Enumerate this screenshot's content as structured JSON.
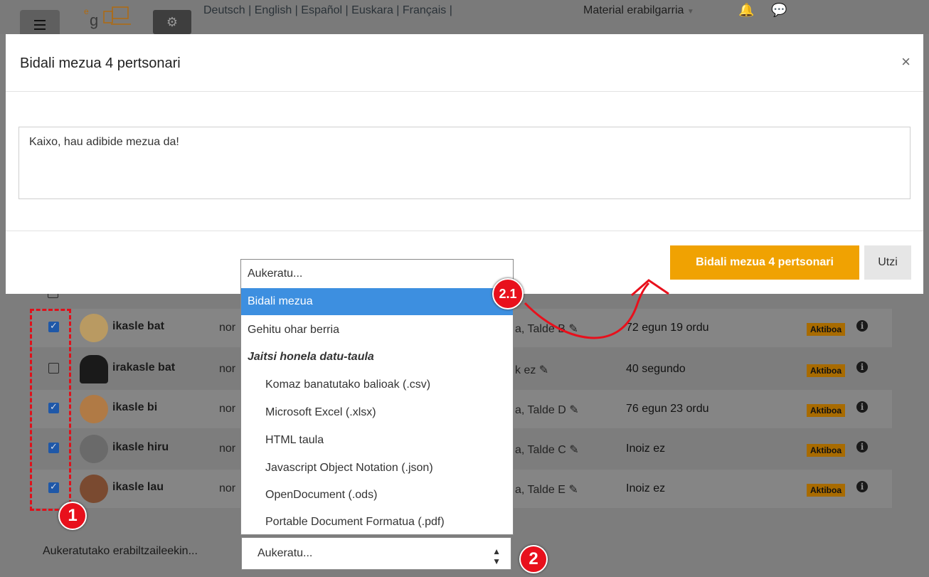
{
  "topbar": {
    "languages": [
      "Deutsch",
      "English",
      "Español",
      "Euskara",
      "Français"
    ],
    "material": "Material erabilgarria"
  },
  "modal": {
    "title": "Bidali mezua 4 pertsonari",
    "close_label": "×",
    "message": "Kaixo, hau adibide mezua da!",
    "send_label": "Bidali mezua 4 pertsonari",
    "cancel_label": "Utzi"
  },
  "dropdown": {
    "options": [
      "Aukeratu...",
      "Bidali mezua",
      "Gehitu ohar berria",
      "Jaitsi honela datu-taula",
      "Komaz banatutako balioak (.csv)",
      "Microsoft Excel (.xlsx)",
      "HTML taula",
      "Javascript Object Notation (.json)",
      "OpenDocument (.ods)",
      "Portable Document Formatua (.pdf)"
    ],
    "selected": "Bidali mezua"
  },
  "table": {
    "rows": [
      {
        "name": "ikasle bat",
        "col": "nor",
        "group": "a, Talde B",
        "last": "72 egun 19 ordu",
        "status": "Aktiboa",
        "checked": true
      },
      {
        "name": "irakasle bat",
        "col": "nor",
        "group": "k ez",
        "last": "40 segundo",
        "status": "Aktiboa",
        "checked": false
      },
      {
        "name": "ikasle bi",
        "col": "nor",
        "group": "a, Talde D",
        "last": "76 egun 23 ordu",
        "status": "Aktiboa",
        "checked": true
      },
      {
        "name": "ikasle hiru",
        "col": "nor",
        "group": "a, Talde C",
        "last": "Inoiz ez",
        "status": "Aktiboa",
        "checked": true
      },
      {
        "name": "ikasle lau",
        "col": "nor",
        "group": "a, Talde E",
        "last": "Inoiz ez",
        "status": "Aktiboa",
        "checked": true
      }
    ]
  },
  "bulk": {
    "label": "Aukeratutako erabiltzaileekin...",
    "select_value": "Aukeratu..."
  },
  "annotations": {
    "badge1": "1",
    "badge2": "2",
    "badge21": "2.1"
  },
  "colors": {
    "send_button": "#f0a202",
    "selected_option": "#3d8fe0",
    "annotation": "#e8101c",
    "status_badge": "#a86b00"
  }
}
